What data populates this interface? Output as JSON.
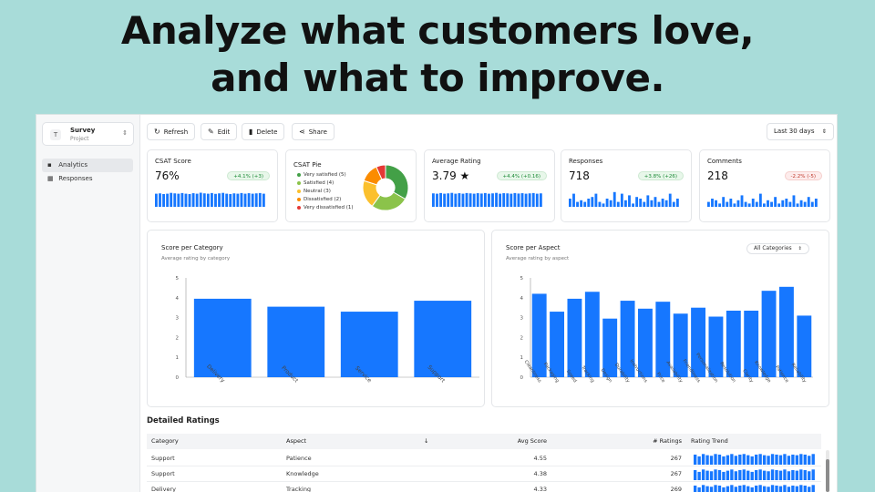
{
  "headline": {
    "line1": "Analyze what customers love,",
    "line2": "and what to improve."
  },
  "colors": {
    "accent": "#1a73e8",
    "bar": "#1677ff"
  },
  "sidebar": {
    "project": {
      "badge": "T",
      "name": "Survey",
      "type": "Project"
    },
    "items": [
      {
        "label": "Analytics",
        "icon": "bar-chart-icon",
        "active": true
      },
      {
        "label": "Responses",
        "icon": "table-icon",
        "active": false
      }
    ]
  },
  "toolbar": {
    "refresh": "Refresh",
    "edit": "Edit",
    "delete": "Delete",
    "share": "Share",
    "range": "Last 30 days"
  },
  "kpis": {
    "csat": {
      "title": "CSAT Score",
      "value": "76%",
      "delta": "+4.1% (+3)",
      "trend": "pos",
      "spark": [
        0.8,
        0.82,
        0.78,
        0.8,
        0.85,
        0.82,
        0.8,
        0.84,
        0.8,
        0.78,
        0.83,
        0.8,
        0.86,
        0.82,
        0.8,
        0.84,
        0.79,
        0.82,
        0.85,
        0.8,
        0.78,
        0.82,
        0.8,
        0.84,
        0.8,
        0.83,
        0.8,
        0.82,
        0.84,
        0.8
      ]
    },
    "pie": {
      "title": "CSAT Pie",
      "slices": [
        {
          "label": "Very satisfied (5)",
          "value": 5,
          "color": "#43a047"
        },
        {
          "label": "Satisfied (4)",
          "value": 4,
          "color": "#8bc34a"
        },
        {
          "label": "Neutral (3)",
          "value": 3,
          "color": "#fbc02d"
        },
        {
          "label": "Dissatisfied (2)",
          "value": 2,
          "color": "#fb8c00"
        },
        {
          "label": "Very dissatisfied (1)",
          "value": 1,
          "color": "#e53935"
        }
      ]
    },
    "rating": {
      "title": "Average Rating",
      "value": "3.79 ★",
      "delta": "+4.4% (+0.16)",
      "trend": "pos",
      "spark": [
        0.82,
        0.8,
        0.84,
        0.8,
        0.82,
        0.85,
        0.8,
        0.83,
        0.8,
        0.84,
        0.82,
        0.8,
        0.83,
        0.81,
        0.84,
        0.8,
        0.82,
        0.85,
        0.8,
        0.83,
        0.82,
        0.8,
        0.84,
        0.81,
        0.83,
        0.8,
        0.82,
        0.84,
        0.8,
        0.82
      ]
    },
    "responses": {
      "title": "Responses",
      "value": "718",
      "delta": "+3.8% (+26)",
      "trend": "pos",
      "spark": [
        0.5,
        0.8,
        0.3,
        0.4,
        0.3,
        0.5,
        0.6,
        0.8,
        0.3,
        0.2,
        0.5,
        0.4,
        0.9,
        0.3,
        0.8,
        0.4,
        0.7,
        0.2,
        0.6,
        0.5,
        0.3,
        0.7,
        0.4,
        0.6,
        0.3,
        0.5,
        0.4,
        0.8,
        0.3,
        0.5
      ]
    },
    "comments": {
      "title": "Comments",
      "value": "218",
      "delta": "-2.2% (-5)",
      "trend": "neg",
      "spark": [
        0.3,
        0.5,
        0.4,
        0.2,
        0.6,
        0.3,
        0.5,
        0.2,
        0.4,
        0.7,
        0.3,
        0.2,
        0.5,
        0.3,
        0.8,
        0.2,
        0.4,
        0.3,
        0.6,
        0.2,
        0.4,
        0.5,
        0.3,
        0.7,
        0.2,
        0.4,
        0.3,
        0.6,
        0.3,
        0.5
      ]
    }
  },
  "chart_data": [
    {
      "type": "bar",
      "title": "Score per Category",
      "subtitle": "Average rating by category",
      "categories": [
        "Delivery",
        "Product",
        "Service",
        "Support"
      ],
      "values": [
        3.95,
        3.55,
        3.3,
        3.85
      ],
      "ylim": [
        0,
        5
      ],
      "yticks": [
        0,
        1,
        2,
        3,
        4,
        5
      ]
    },
    {
      "type": "bar",
      "title": "Score per Aspect",
      "subtitle": "Average rating by aspect",
      "filter": "All Categories",
      "categories": [
        "Cleanliness",
        "Packaging",
        "Speed",
        "Tracking",
        "Design",
        "Durability",
        "Instructions",
        "Price",
        "Availability",
        "Friendliness",
        "Personalization",
        "Resolution",
        "Clarity",
        "Knowledge",
        "Patience",
        "Reliability"
      ],
      "values": [
        4.2,
        3.3,
        3.95,
        4.3,
        2.95,
        3.85,
        3.45,
        3.8,
        3.2,
        3.5,
        3.05,
        3.35,
        3.35,
        4.35,
        4.55,
        3.1
      ],
      "ylim": [
        0,
        5
      ],
      "yticks": [
        0,
        1,
        2,
        3,
        4,
        5
      ]
    }
  ],
  "table": {
    "section_title": "Detailed Ratings",
    "headers": [
      "Category",
      "Aspect",
      "Avg Score",
      "# Ratings",
      "Rating Trend"
    ],
    "sort_icon": "↓",
    "rows": [
      {
        "category": "Support",
        "aspect": "Patience",
        "avg": "4.55",
        "count": "267"
      },
      {
        "category": "Support",
        "aspect": "Knowledge",
        "avg": "4.38",
        "count": "267"
      },
      {
        "category": "Delivery",
        "aspect": "Tracking",
        "avg": "4.33",
        "count": "269"
      }
    ]
  }
}
